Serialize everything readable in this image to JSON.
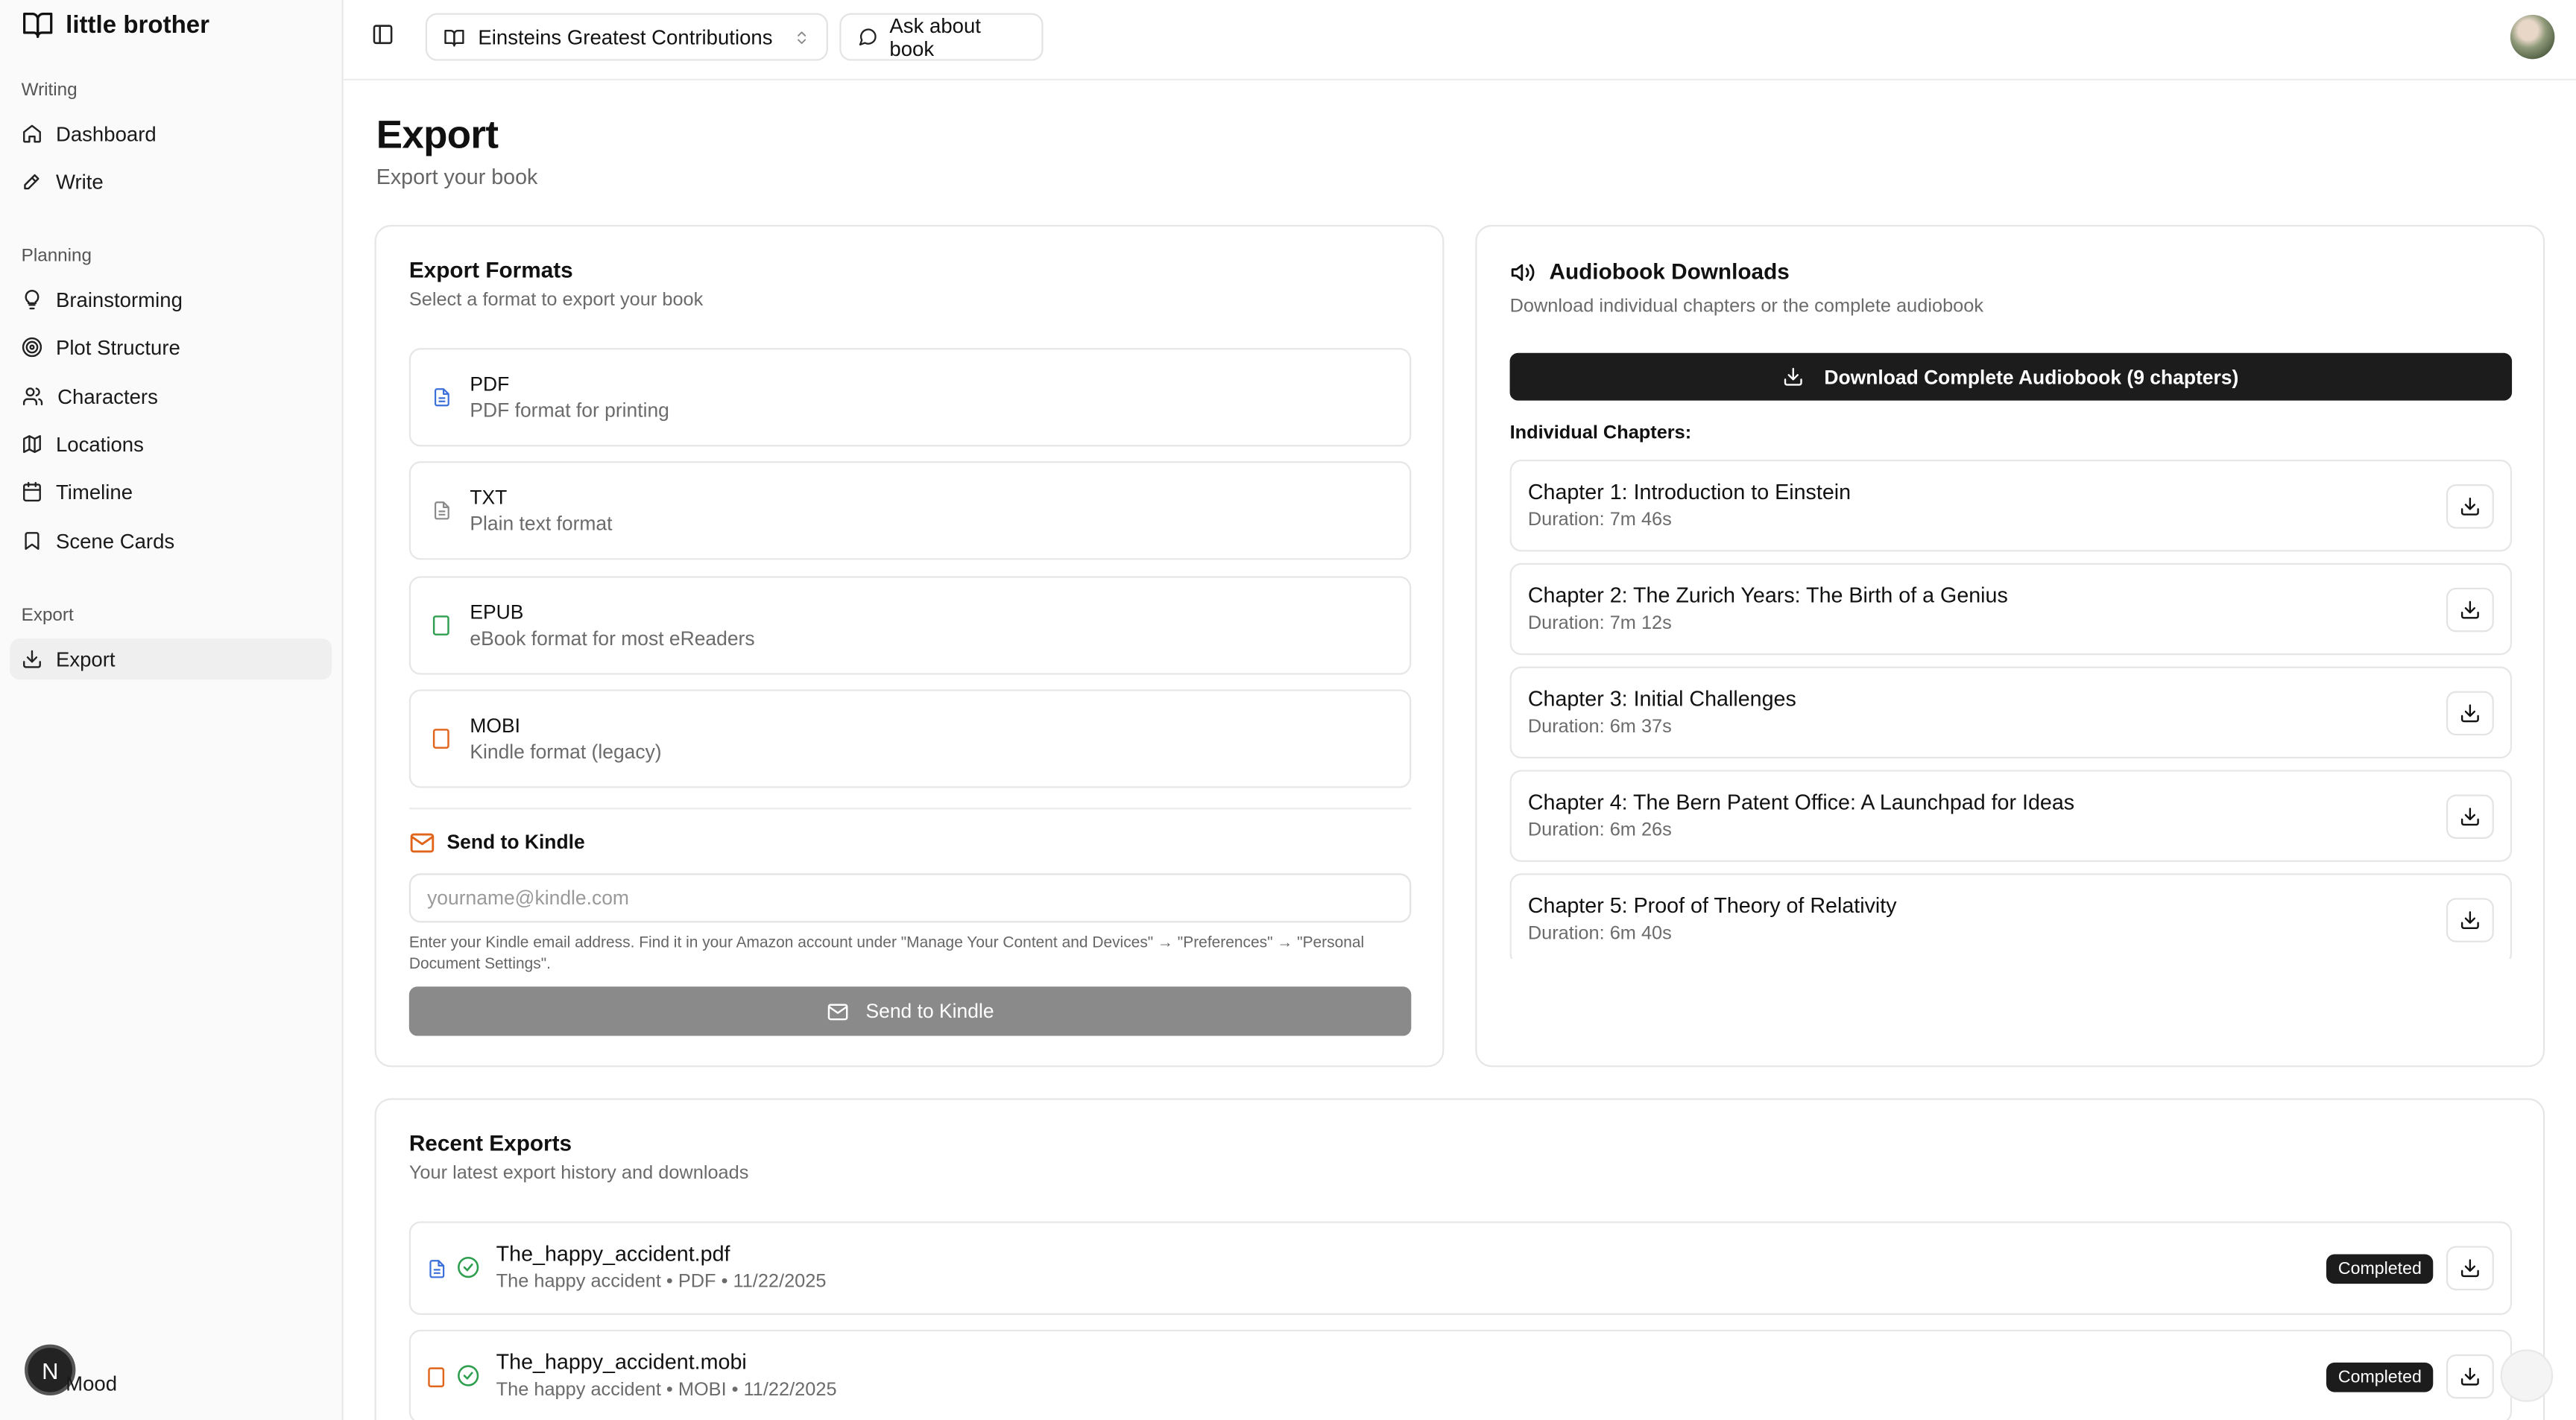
{
  "app": {
    "name": "little brother"
  },
  "sidebar": {
    "groups": [
      {
        "label": "Writing",
        "items": [
          {
            "label": "Dashboard",
            "icon": "home-icon"
          },
          {
            "label": "Write",
            "icon": "pen-icon"
          }
        ]
      },
      {
        "label": "Planning",
        "items": [
          {
            "label": "Brainstorming",
            "icon": "lightbulb-icon"
          },
          {
            "label": "Plot Structure",
            "icon": "target-icon"
          },
          {
            "label": "Characters",
            "icon": "users-icon"
          },
          {
            "label": "Locations",
            "icon": "map-icon"
          },
          {
            "label": "Timeline",
            "icon": "calendar-icon"
          },
          {
            "label": "Scene Cards",
            "icon": "bookmark-icon"
          }
        ]
      },
      {
        "label": "Export",
        "items": [
          {
            "label": "Export",
            "icon": "download-icon",
            "active": true
          }
        ]
      }
    ],
    "user": {
      "initial": "N",
      "name": "Mood"
    }
  },
  "topbar": {
    "book_select": "Einsteins Greatest Contributions",
    "ask_button": "Ask about book"
  },
  "page": {
    "title": "Export",
    "subtitle": "Export your book"
  },
  "formats": {
    "title": "Export Formats",
    "description": "Select a format to export your book",
    "items": [
      {
        "name": "PDF",
        "desc": "PDF format for printing",
        "color": "#3b6fd9"
      },
      {
        "name": "TXT",
        "desc": "Plain text format",
        "color": "#8a8a8a"
      },
      {
        "name": "EPUB",
        "desc": "eBook format for most eReaders",
        "color": "#2e9e4f"
      },
      {
        "name": "MOBI",
        "desc": "Kindle format (legacy)",
        "color": "#e0641a"
      }
    ],
    "kindle": {
      "title": "Send to Kindle",
      "placeholder": "yourname@kindle.com",
      "help": "Enter your Kindle email address. Find it in your Amazon account under \"Manage Your Content and Devices\" → \"Preferences\" → \"Personal Document Settings\".",
      "button": "Send to Kindle",
      "accent": "#e0641a"
    }
  },
  "audiobook": {
    "title": "Audiobook Downloads",
    "description": "Download individual chapters or the complete audiobook",
    "download_all": "Download Complete Audiobook (9 chapters)",
    "chapters_label": "Individual Chapters:",
    "chapters": [
      {
        "title": "Chapter 1: Introduction to Einstein",
        "duration": "Duration: 7m 46s"
      },
      {
        "title": "Chapter 2: The Zurich Years: The Birth of a Genius",
        "duration": "Duration: 7m 12s"
      },
      {
        "title": "Chapter 3: Initial Challenges",
        "duration": "Duration: 6m 37s"
      },
      {
        "title": "Chapter 4: The Bern Patent Office: A Launchpad for Ideas",
        "duration": "Duration: 6m 26s"
      },
      {
        "title": "Chapter 5: Proof of Theory of Relativity",
        "duration": "Duration: 6m 40s"
      }
    ]
  },
  "recent": {
    "title": "Recent Exports",
    "description": "Your latest export history and downloads",
    "items": [
      {
        "name": "The_happy_accident.pdf",
        "meta": "The happy accident • PDF • 11/22/2025",
        "status": "Completed",
        "color": "#3b6fd9"
      },
      {
        "name": "The_happy_accident.mobi",
        "meta": "The happy accident • MOBI • 11/22/2025",
        "status": "Completed",
        "color": "#e0641a"
      }
    ]
  }
}
